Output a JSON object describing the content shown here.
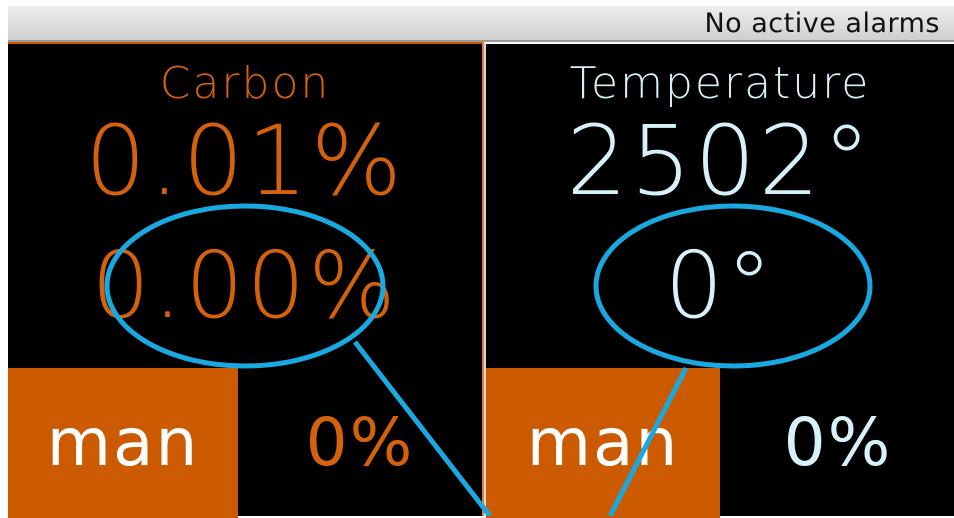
{
  "status_bar": {
    "text": "No active alarms"
  },
  "carbon": {
    "title": "Carbon",
    "actual": "0.01%",
    "setpoint": "0.00%",
    "mode": "man",
    "output": "0%"
  },
  "temperature": {
    "title": "Temperature",
    "actual": "2502°",
    "setpoint": "0°",
    "mode": "man",
    "output": "0%"
  },
  "colors": {
    "carbon_accent": "#d4610c",
    "mode_button": "#cc5a00",
    "temperature_text": "#d6f1f7",
    "annotation": "#1aa8e0",
    "panel_background": "#000000"
  }
}
